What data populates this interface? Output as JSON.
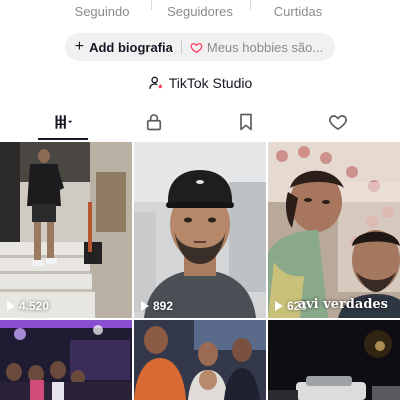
{
  "stats": [
    {
      "label": "Seguindo"
    },
    {
      "label": "Seguidores"
    },
    {
      "label": "Curtidas"
    }
  ],
  "bio": {
    "add_label": "Add biografia",
    "hobbies_label": "Meus hobbies são..."
  },
  "studio": {
    "label": "TikTok Studio"
  },
  "tabs": [
    {
      "icon": "grid-icon"
    },
    {
      "icon": "lock-icon"
    },
    {
      "icon": "bookmark-icon"
    },
    {
      "icon": "heart-icon"
    }
  ],
  "videos": [
    {
      "views": "4.520",
      "icon": "play-icon"
    },
    {
      "views": "892",
      "icon": "play-icon"
    },
    {
      "views": "623",
      "overlay_text": "avi verdades",
      "icon": "play-icon"
    },
    {
      "views": ""
    },
    {
      "views": ""
    },
    {
      "views": ""
    }
  ],
  "colors": {
    "text": "#161823",
    "secondary": "#8a8b91",
    "pill_bg": "#f1f1f2",
    "accent": "#fe2c55"
  }
}
